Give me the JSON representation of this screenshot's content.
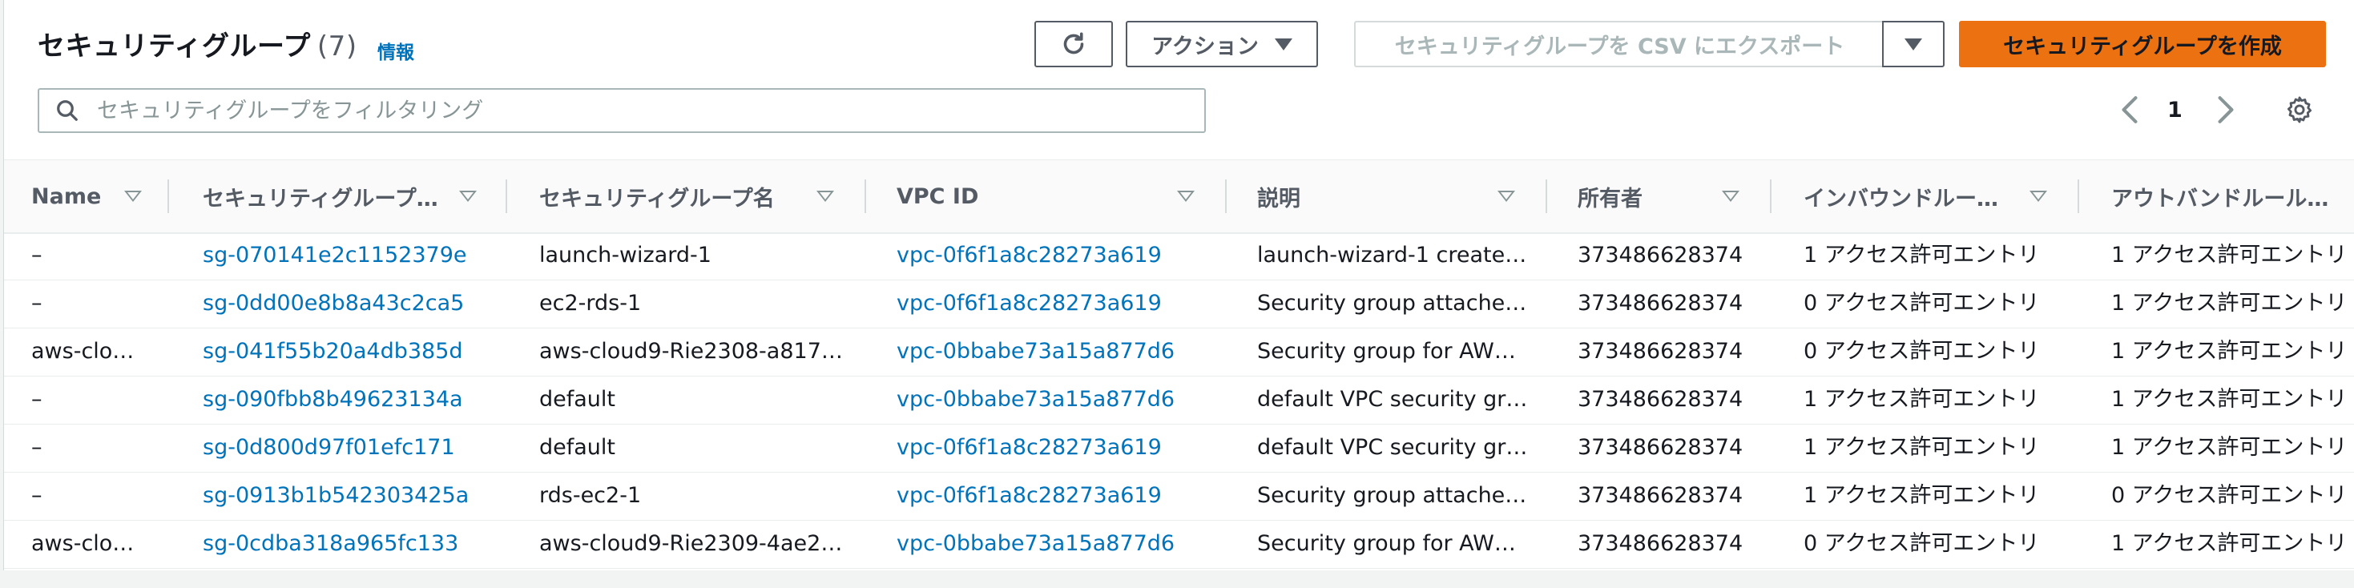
{
  "header": {
    "title": "セキュリティグループ",
    "count": "(7)",
    "info_link": "情報"
  },
  "toolbar": {
    "refresh_icon": "refresh-icon",
    "actions_label": "アクション",
    "export_label": "セキュリティグループを CSV にエクスポート",
    "create_label": "セキュリティグループを作成"
  },
  "search": {
    "placeholder": "セキュリティグループをフィルタリング",
    "value": ""
  },
  "pagination": {
    "current_page": "1",
    "prev_icon": "chevron-left-icon",
    "next_icon": "chevron-right-icon",
    "settings_icon": "gear-icon"
  },
  "table": {
    "columns": [
      "Name",
      "セキュリティグループ…",
      "セキュリティグループ名",
      "VPC ID",
      "説明",
      "所有者",
      "インバウンドルー…",
      "アウトバンドルール…"
    ],
    "rows": [
      [
        "–",
        "sg-070141e2c1152379e",
        "launch-wizard-1",
        "vpc-0f6f1a8c28273a619",
        "launch-wizard-1 create…",
        "373486628374",
        "1 アクセス許可エントリ",
        "1 アクセス許可エントリ"
      ],
      [
        "–",
        "sg-0dd00e8b8a43c2ca5",
        "ec2-rds-1",
        "vpc-0f6f1a8c28273a619",
        "Security group attache…",
        "373486628374",
        "0 アクセス許可エントリ",
        "1 アクセス許可エントリ"
      ],
      [
        "aws-clo…",
        "sg-041f55b20a4db385d",
        "aws-cloud9-Rie2308-a817…",
        "vpc-0bbabe73a15a877d6",
        "Security group for AW…",
        "373486628374",
        "0 アクセス許可エントリ",
        "1 アクセス許可エントリ"
      ],
      [
        "–",
        "sg-090fbb8b49623134a",
        "default",
        "vpc-0bbabe73a15a877d6",
        "default VPC security gr…",
        "373486628374",
        "1 アクセス許可エントリ",
        "1 アクセス許可エントリ"
      ],
      [
        "–",
        "sg-0d800d97f01efc171",
        "default",
        "vpc-0f6f1a8c28273a619",
        "default VPC security gr…",
        "373486628374",
        "1 アクセス許可エントリ",
        "1 アクセス許可エントリ"
      ],
      [
        "–",
        "sg-0913b1b542303425a",
        "rds-ec2-1",
        "vpc-0f6f1a8c28273a619",
        "Security group attache…",
        "373486628374",
        "1 アクセス許可エントリ",
        "0 アクセス許可エントリ"
      ],
      [
        "aws-clo…",
        "sg-0cdba318a965fc133",
        "aws-cloud9-Rie2309-4ae2…",
        "vpc-0bbabe73a15a877d6",
        "Security group for AW…",
        "373486628374",
        "0 アクセス許可エントリ",
        "1 アクセス許可エントリ"
      ]
    ]
  },
  "colors": {
    "link": "#0073bb",
    "primary_button": "#ec7211",
    "text": "#16191f"
  }
}
